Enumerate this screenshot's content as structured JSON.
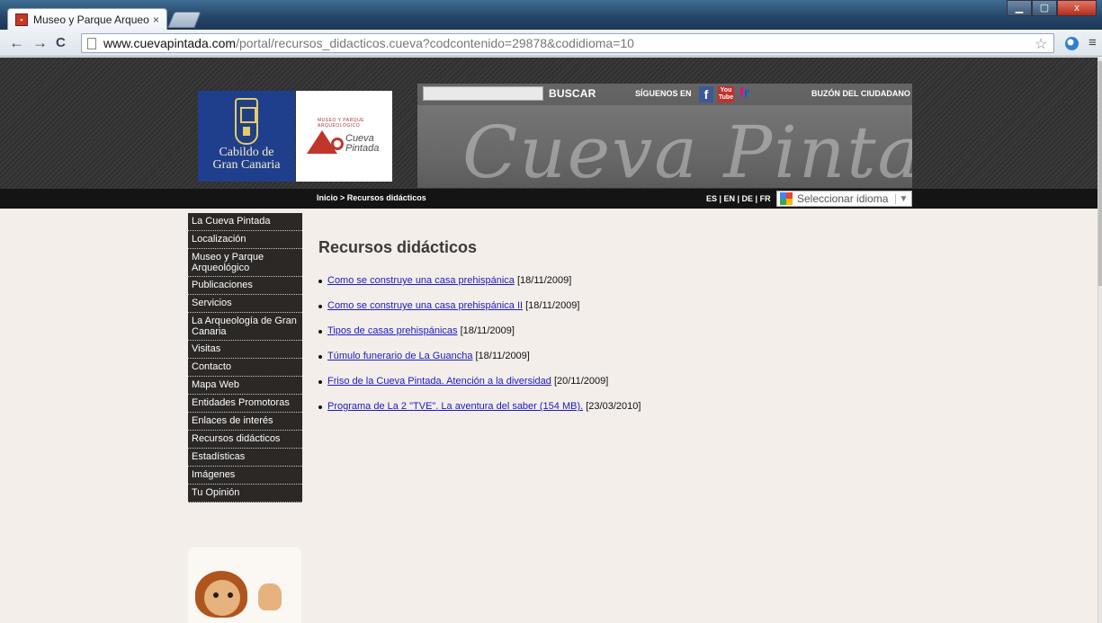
{
  "browser": {
    "tab_title": "Museo y Parque Arqueoló",
    "tab_close": "×",
    "url_host": "www.cuevapintada.com",
    "url_path": "/portal/recursos_didacticos.cueva?codcontenido=29878&codidioma=10",
    "back": "←",
    "forward": "→",
    "reload": "C",
    "star": "☆",
    "menu": "≡",
    "win_min": "▁",
    "win_max": "▢",
    "win_close": "x"
  },
  "header": {
    "cabildo_line1": "Cabildo de",
    "cabildo_line2": "Gran Canaria",
    "cueva_small": "MUSEO Y PARQUE ARQUEOLÓGICO",
    "cueva_name_1": "Cueva",
    "cueva_name_2": "Pintada",
    "search_button": "BUSCAR",
    "follow_label": "SÍGUENOS EN",
    "fb": "f",
    "yt_top": "You",
    "yt_bottom": "Tube",
    "fr_1": "f",
    "fr_2": "r",
    "buzon": "BUZÓN DEL CIUDADANO",
    "banner_script": "Cueva Pintada"
  },
  "navbar": {
    "breadcrumb": "Inicio > Recursos didácticos",
    "languages": "ES | EN | DE | FR",
    "language_select": "Seleccionar idioma",
    "select_arrow": "▼"
  },
  "sidebar": {
    "items": [
      {
        "label": "La Cueva Pintada"
      },
      {
        "label": "Localización"
      },
      {
        "label": "Museo y Parque Arqueológico"
      },
      {
        "label": "Publicaciones"
      },
      {
        "label": "Servicios"
      },
      {
        "label": "La Arqueología de Gran Canaria"
      },
      {
        "label": "Visitas"
      },
      {
        "label": "Contacto"
      },
      {
        "label": "Mapa Web"
      },
      {
        "label": "Entidades Promotoras"
      },
      {
        "label": "Enlaces de interés"
      },
      {
        "label": "Recursos didácticos"
      },
      {
        "label": "Estadísticas"
      },
      {
        "label": "Imágenes"
      },
      {
        "label": "Tu Opinión"
      }
    ]
  },
  "content": {
    "title": "Recursos didácticos",
    "resources": [
      {
        "title": "Como se construye una casa prehispánica",
        "date": "[18/11/2009]"
      },
      {
        "title": "Como se construye una casa prehispánica II",
        "date": "[18/11/2009]"
      },
      {
        "title": "Tipos de casas prehispánicas",
        "date": "[18/11/2009]"
      },
      {
        "title": "Túmulo funerario de La Guancha",
        "date": "[18/11/2009]"
      },
      {
        "title": "Friso de la Cueva Pintada. Atención a la diversidad",
        "date": "[20/11/2009]"
      },
      {
        "title": "Programa de La 2 \"TVE\". La aventura del saber (154 MB).",
        "date": "[23/03/2010]"
      }
    ]
  },
  "colors": {
    "link": "#1b1bc6",
    "sidebar_bg": "#2b2826",
    "page_bg": "#f3eeea",
    "cabildo_blue": "#1f3f8d",
    "cueva_red": "#c0362c"
  }
}
